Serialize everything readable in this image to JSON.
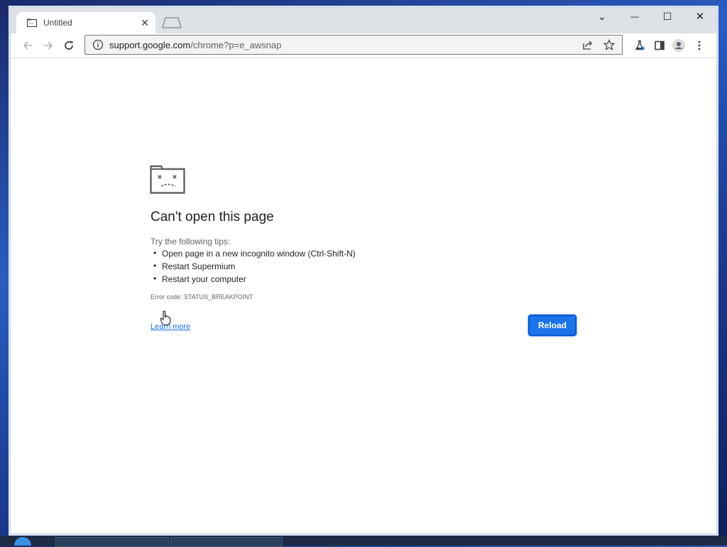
{
  "tab": {
    "title": "Untitled",
    "close_glyph": "✕"
  },
  "window_controls": {
    "collapse": "⌄",
    "minimize": "—",
    "maximize": "☐",
    "close": "✕"
  },
  "omnibox": {
    "host": "support.google.com",
    "path": "/chrome?p=e_awsnap"
  },
  "error_page": {
    "heading": "Can't open this page",
    "tips_label": "Try the following tips:",
    "tips": [
      "Open page in a new incognito window (Ctrl-Shift-N)",
      "Restart Supermium",
      "Restart your computer"
    ],
    "error_code": "Error code: STATUS_BREAKPOINT",
    "learn_more": "Learn more",
    "reload_label": "Reload"
  },
  "colors": {
    "accent": "#1a73e8",
    "tabstrip": "#dee1e6"
  }
}
